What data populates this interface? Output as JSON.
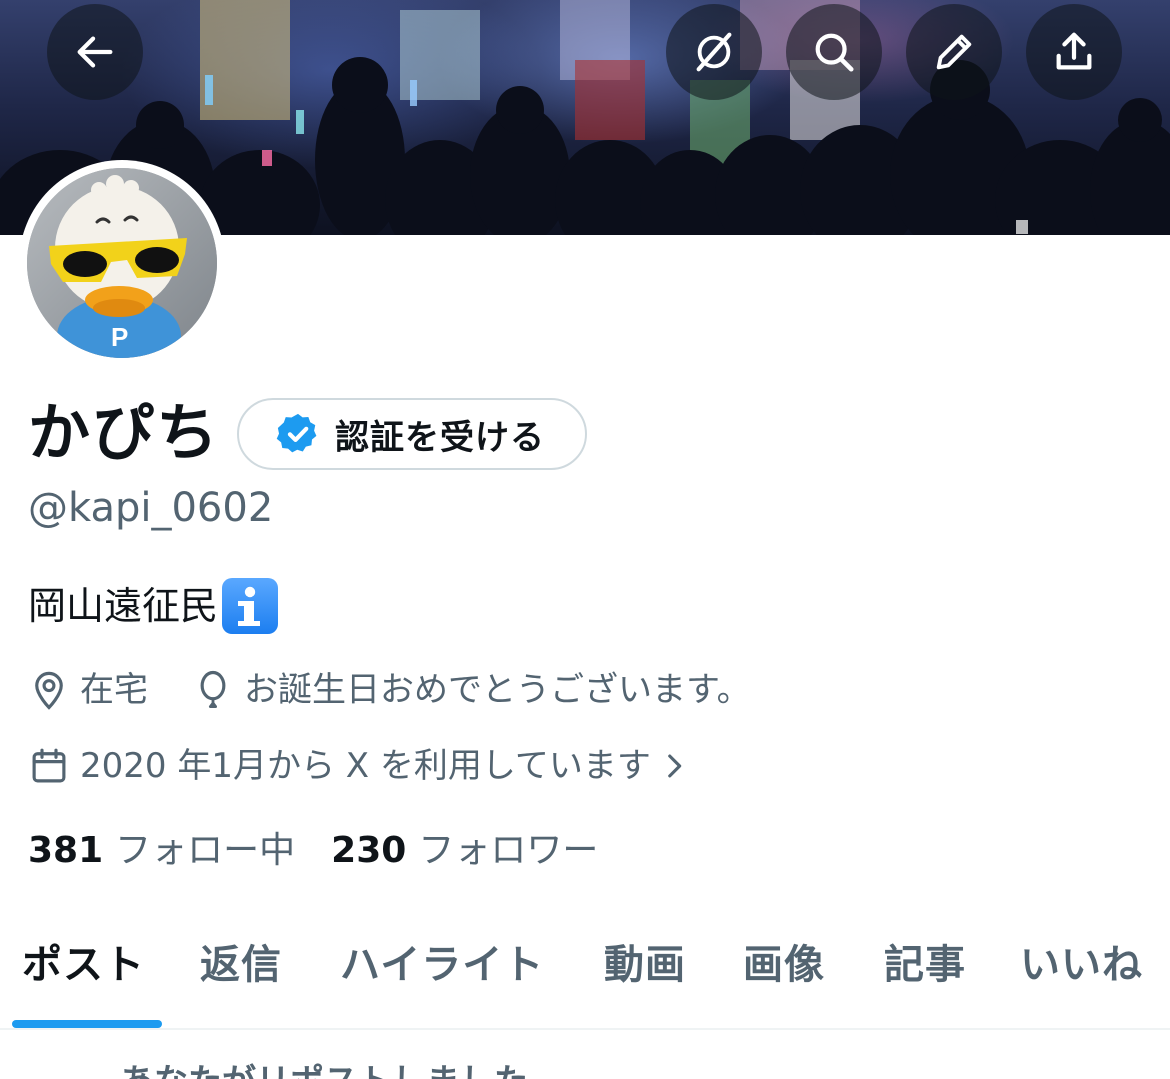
{
  "header": {
    "back_icon": "arrow-left-icon",
    "actions": [
      "grok-icon",
      "search-icon",
      "edit-icon",
      "share-icon"
    ]
  },
  "profile": {
    "display_name": "かぴち",
    "verify_label": "認証を受ける",
    "handle": "@kapi_0602",
    "bio": "岡山遠征民",
    "bio_emoji": "information-emoji",
    "location": "在宅",
    "birthday": "お誕生日おめでとうございます。",
    "joined": "2020 年1月から X を利用しています",
    "following_count": "381",
    "following_label": "フォロー中",
    "followers_count": "230",
    "followers_label": "フォロワー"
  },
  "tabs": [
    {
      "label": "ポスト",
      "active": true
    },
    {
      "label": "返信"
    },
    {
      "label": "ハイライト"
    },
    {
      "label": "動画"
    },
    {
      "label": "画像"
    },
    {
      "label": "記事"
    },
    {
      "label": "いいね"
    }
  ],
  "feed": {
    "repost_context": "あなたがリポストしました"
  },
  "colors": {
    "accent": "#1d9bf0",
    "secondary_text": "#536471",
    "primary_text": "#0f1419",
    "border": "#cfd9de"
  }
}
